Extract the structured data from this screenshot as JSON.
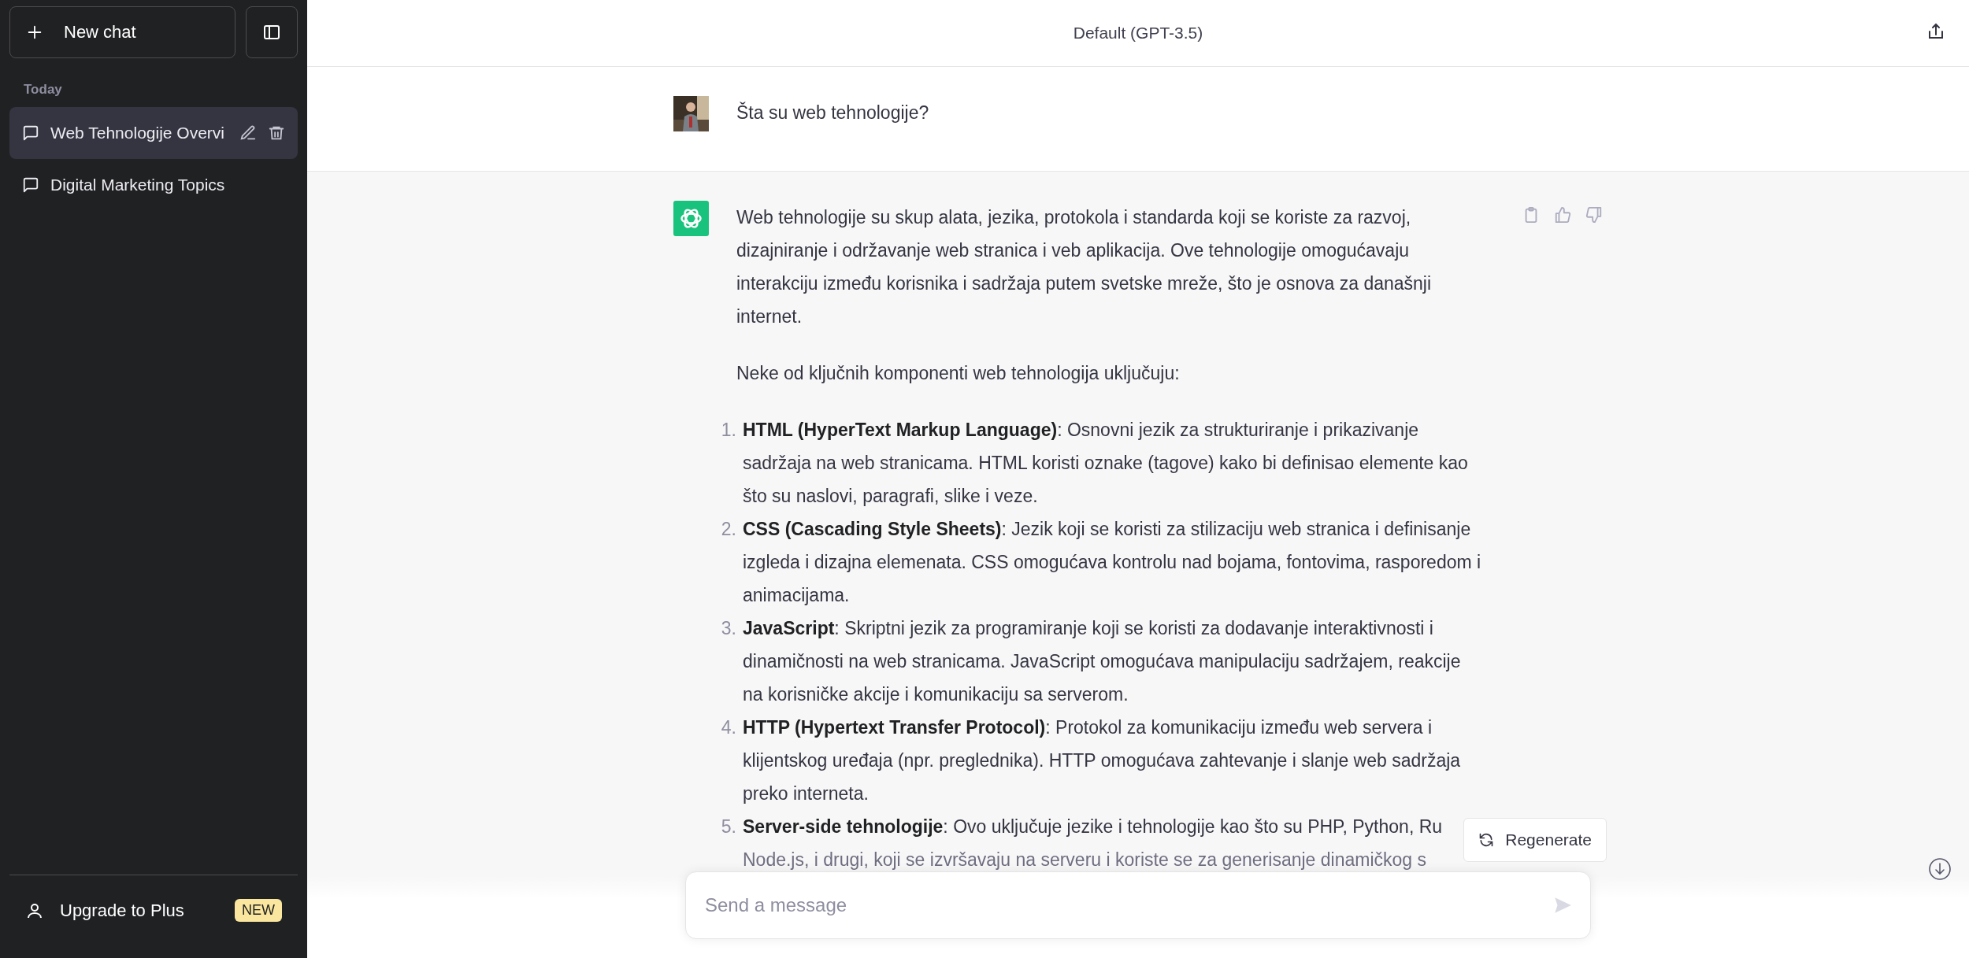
{
  "sidebar": {
    "new_chat_button": "New chat",
    "section_label": "Today",
    "chats": [
      {
        "title": "Web Tehnologije Overvi",
        "selected": true
      },
      {
        "title": "Digital Marketing Topics",
        "selected": false
      }
    ],
    "upgrade": {
      "label": "Upgrade to Plus",
      "badge": "NEW"
    }
  },
  "header": {
    "title": "Default (GPT-3.5)"
  },
  "messages": [
    {
      "kind": "user",
      "paragraphs": [
        "Šta su web tehnologije?"
      ]
    },
    {
      "kind": "assistant",
      "paragraphs": [
        "Web tehnologije su skup alata, jezika, protokola i standarda koji se koriste za razvoj, dizajniranje i održavanje web stranica i veb aplikacija. Ove tehnologije omogućavaju interakciju između korisnika i sadržaja putem svetske mreže, što je osnova za današnji internet.",
        "Neke od ključnih komponenti web tehnologija uključuju:"
      ],
      "list": [
        {
          "number": "1.",
          "term": "HTML (HyperText Markup Language)",
          "text": ": Osnovni jezik za strukturiranje i prikazivanje sadržaja na web stranicama. HTML koristi oznake (tagove) kako bi definisao elemente kao što su naslovi, paragrafi, slike i veze."
        },
        {
          "number": "2.",
          "term": "CSS (Cascading Style Sheets)",
          "text": ": Jezik koji se koristi za stilizaciju web stranica i definisanje izgleda i dizajna elemenata. CSS omogućava kontrolu nad bojama, fontovima, rasporedom i animacijama."
        },
        {
          "number": "3.",
          "term": "JavaScript",
          "text": ": Skriptni jezik za programiranje koji se koristi za dodavanje interaktivnosti i dinamičnosti na web stranicama. JavaScript omogućava manipulaciju sadržajem, reakcije na korisničke akcije i komunikaciju sa serverom."
        },
        {
          "number": "4.",
          "term": "HTTP (Hypertext Transfer Protocol)",
          "text": ": Protokol za komunikaciju između web servera i klijentskog uređaja (npr. preglednika). HTTP omogućava zahtevanje i slanje web sadržaja preko interneta."
        },
        {
          "number": "5.",
          "term": "Server-side tehnologije",
          "text": ": Ovo uključuje jezike i tehnologije kao što su PHP, Python, Ru",
          "overflow": "Node.js, i drugi, koji se izvršavaju na serveru i koriste se za generisanje dinamičkog s"
        }
      ]
    }
  ],
  "regenerate_button": "Regenerate",
  "composer": {
    "placeholder": "Send a message"
  }
}
